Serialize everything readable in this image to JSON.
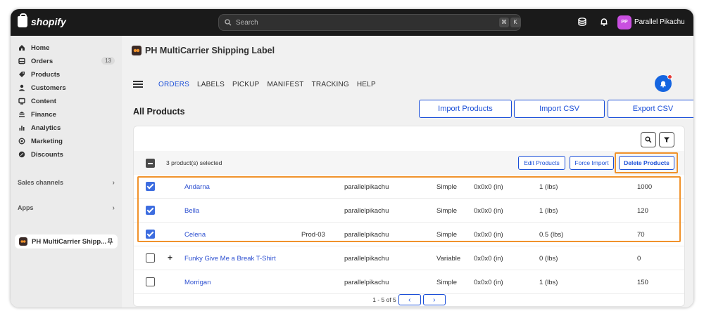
{
  "topbar": {
    "brand": "shopify",
    "search_placeholder": "Search",
    "shortcut_keys": [
      "⌘",
      "K"
    ],
    "user_initials": "PP",
    "user_name": "Parallel Pikachu"
  },
  "sidebar": {
    "items": [
      {
        "label": "Home",
        "icon": "home-icon"
      },
      {
        "label": "Orders",
        "icon": "orders-icon",
        "badge": "13"
      },
      {
        "label": "Products",
        "icon": "tag-icon"
      },
      {
        "label": "Customers",
        "icon": "person-icon"
      },
      {
        "label": "Content",
        "icon": "content-icon"
      },
      {
        "label": "Finance",
        "icon": "bank-icon"
      },
      {
        "label": "Analytics",
        "icon": "bar-chart-icon"
      },
      {
        "label": "Marketing",
        "icon": "target-icon"
      },
      {
        "label": "Discounts",
        "icon": "discount-icon"
      }
    ],
    "sales_channels_label": "Sales channels",
    "apps_label": "Apps",
    "app_item_label": "PH MultiCarrier Shipp..."
  },
  "app": {
    "title": "PH MultiCarrier Shipping Label",
    "menu": [
      "ORDERS",
      "LABELS",
      "PICKUP",
      "MANIFEST",
      "TRACKING",
      "HELP"
    ],
    "active_menu": "ORDERS",
    "page_heading": "All Products",
    "buttons": {
      "import_products": "Import Products",
      "import_csv": "Import CSV",
      "export_csv": "Export CSV",
      "edit_products": "Edit Products",
      "force_import": "Force Import",
      "delete_products": "Delete Products"
    },
    "selection_text": "3 product(s) selected"
  },
  "products": [
    {
      "checked": true,
      "has_variants": false,
      "name": "Andarna",
      "sku": "",
      "vendor": "parallelpikachu",
      "type": "Simple",
      "dimensions": "0x0x0 (in)",
      "weight": "1 (lbs)",
      "quantity": "1000"
    },
    {
      "checked": true,
      "has_variants": false,
      "name": "Bella",
      "sku": "",
      "vendor": "parallelpikachu",
      "type": "Simple",
      "dimensions": "0x0x0 (in)",
      "weight": "1 (lbs)",
      "quantity": "120"
    },
    {
      "checked": true,
      "has_variants": false,
      "name": "Celena",
      "sku": "Prod-03",
      "vendor": "parallelpikachu",
      "type": "Simple",
      "dimensions": "0x0x0 (in)",
      "weight": "0.5 (lbs)",
      "quantity": "70"
    },
    {
      "checked": false,
      "has_variants": true,
      "name": "Funky Give Me a Break T-Shirt",
      "sku": "",
      "vendor": "parallelpikachu",
      "type": "Variable",
      "dimensions": "0x0x0 (in)",
      "weight": "0 (lbs)",
      "quantity": "0"
    },
    {
      "checked": false,
      "has_variants": false,
      "name": "Morrigan",
      "sku": "",
      "vendor": "parallelpikachu",
      "type": "Simple",
      "dimensions": "0x0x0 (in)",
      "weight": "1 (lbs)",
      "quantity": "150"
    }
  ],
  "pagination": {
    "range_text": "1 - 5 of 5",
    "prev": "‹",
    "next": "›"
  },
  "colors": {
    "accent": "#1b4fd8",
    "highlight": "#f0922b",
    "checkbox": "#3d6de0"
  }
}
